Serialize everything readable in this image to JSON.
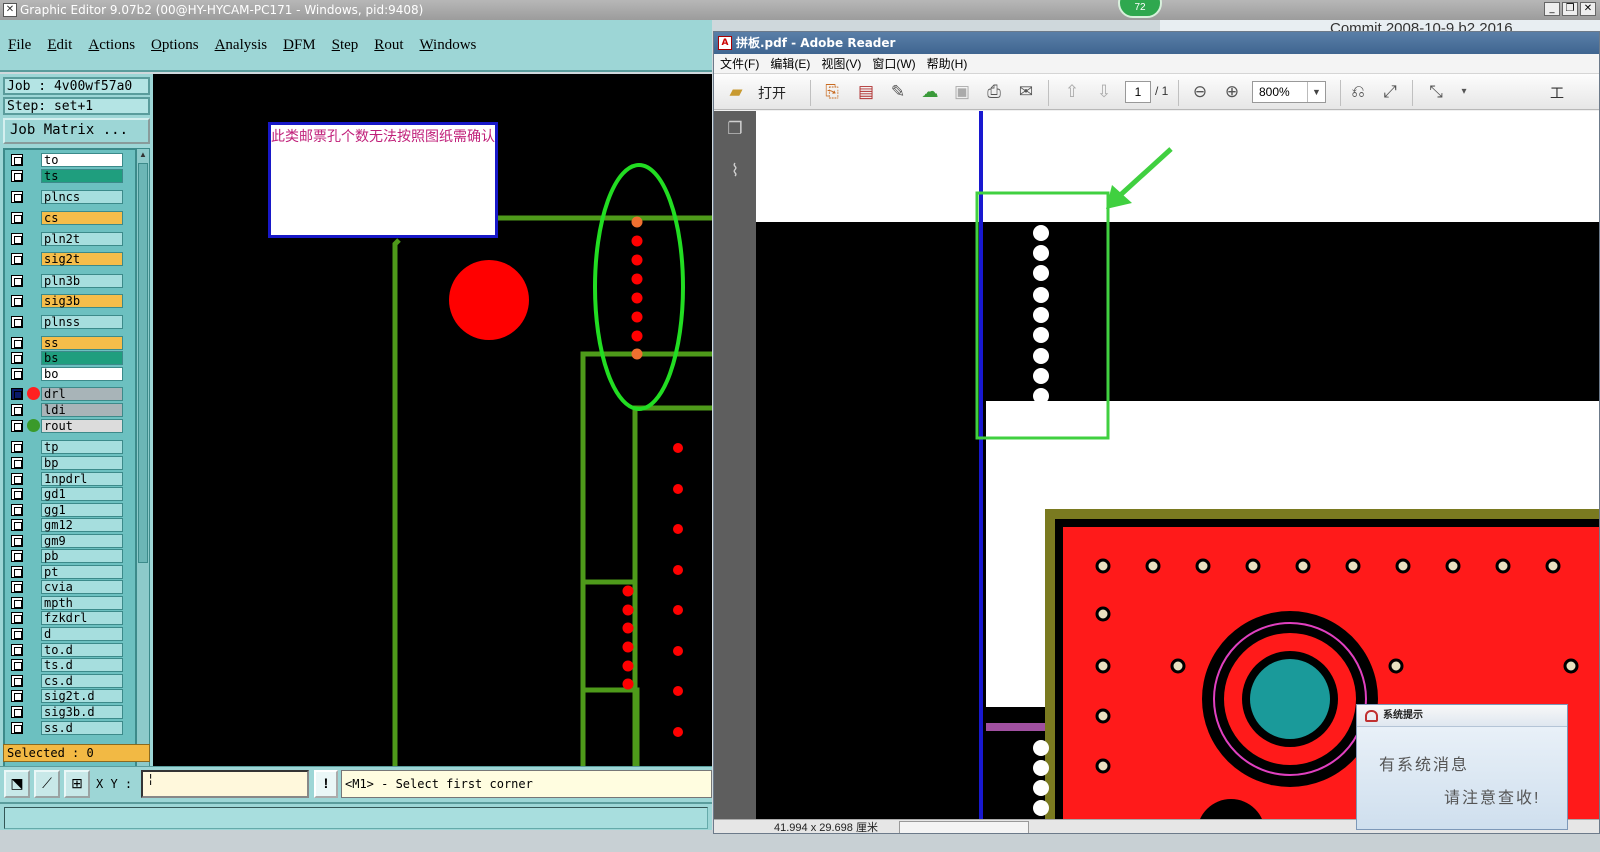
{
  "graphic_editor": {
    "title": "Graphic Editor 9.07b2 (00@HY-HYCAM-PC171 - Windows, pid:9408)",
    "menu": [
      "File",
      "Edit",
      "Actions",
      "Options",
      "Analysis",
      "DFM",
      "Step",
      "Rout",
      "Windows"
    ],
    "job_label": "Job : 4v00wf57a0",
    "step_label": "Step: set+1",
    "job_matrix_button": "Job Matrix ...",
    "layers": [
      {
        "name": "to",
        "color": "#ffffff"
      },
      {
        "name": "ts",
        "color": "#1f9e7e"
      },
      {
        "name": "plncs",
        "color": "#a6dede"
      },
      {
        "name": "cs",
        "color": "#f5bd4a"
      },
      {
        "name": "pln2t",
        "color": "#a6dede"
      },
      {
        "name": "sig2t",
        "color": "#f5bd4a"
      },
      {
        "name": "pln3b",
        "color": "#a6dede"
      },
      {
        "name": "sig3b",
        "color": "#f5bd4a"
      },
      {
        "name": "plnss",
        "color": "#a6dede"
      },
      {
        "name": "ss",
        "color": "#f5bd4a"
      },
      {
        "name": "bs",
        "color": "#1f9e7e"
      },
      {
        "name": "bo",
        "color": "#ffffff"
      },
      {
        "name": "drl",
        "color": "#a8b4b8"
      },
      {
        "name": "ldi",
        "color": "#a8b4b8"
      },
      {
        "name": "rout",
        "color": "#dcdcdc"
      },
      {
        "name": "tp",
        "color": "#a6dede"
      },
      {
        "name": "bp",
        "color": "#a6dede"
      },
      {
        "name": "1npdrl",
        "color": "#a6dede"
      },
      {
        "name": "gd1",
        "color": "#a6dede"
      },
      {
        "name": "gg1",
        "color": "#a6dede"
      },
      {
        "name": "gm12",
        "color": "#a6dede"
      },
      {
        "name": "gm9",
        "color": "#a6dede"
      },
      {
        "name": "pb",
        "color": "#a6dede"
      },
      {
        "name": "pt",
        "color": "#a6dede"
      },
      {
        "name": "cvia",
        "color": "#a6dede"
      },
      {
        "name": "mpth",
        "color": "#a6dede"
      },
      {
        "name": "fzkdrl",
        "color": "#a6dede"
      },
      {
        "name": "d",
        "color": "#a6dede"
      },
      {
        "name": "to.d",
        "color": "#a6dede"
      },
      {
        "name": "ts.d",
        "color": "#a6dede"
      },
      {
        "name": "cs.d",
        "color": "#a6dede"
      },
      {
        "name": "sig2t.d",
        "color": "#a6dede"
      },
      {
        "name": "sig3b.d",
        "color": "#a6dede"
      },
      {
        "name": "ss.d",
        "color": "#a6dede"
      }
    ],
    "selected_label": "Selected : 0",
    "canvas_note": "此类邮票孔个数无法按照图纸需确认",
    "xy_label": "X Y :",
    "message_button": "!",
    "message_text": "<M1> - Select first corner"
  },
  "notification_badge": "72",
  "background_window_fragment": "Commit 2008-10-9 b2 2016",
  "adobe_reader": {
    "title": "拼板.pdf - Adobe Reader",
    "menu": [
      "文件(F)",
      "编辑(E)",
      "视图(V)",
      "窗口(W)",
      "帮助(H)"
    ],
    "open_label": "打开",
    "page_current": "1",
    "page_total": "/ 1",
    "zoom": "800%",
    "toolbar_tail": "工",
    "status_dimensions": "41.994 x 29.698 厘米"
  },
  "system_popup": {
    "title": "系统提示",
    "line1": "有系统消息",
    "line2": "请注意查收!"
  },
  "colors": {
    "teal_panel": "#9dd6d6",
    "canvas_bg": "#000000",
    "trace_green": "#4e9a1a",
    "drill_red": "#ff0000",
    "highlight_green": "#22dd22",
    "reader_titlebar": "#4a6f9a"
  }
}
